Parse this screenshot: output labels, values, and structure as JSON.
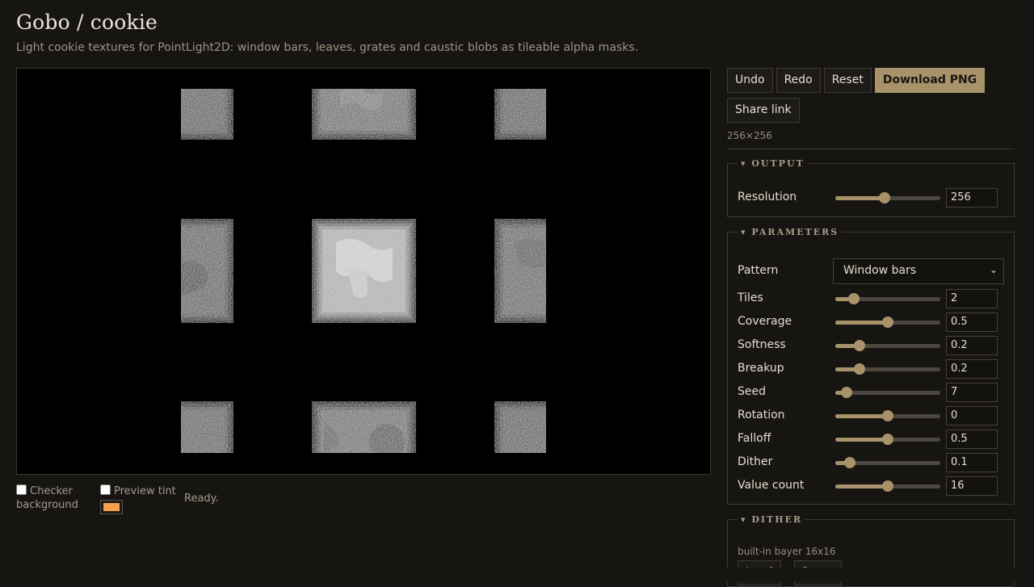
{
  "header": {
    "title": "Gobo / cookie",
    "subtitle": "Light cookie textures for PointLight2D: window bars, leaves, grates and caustic blobs as tileable alpha masks."
  },
  "toolbar": {
    "undo": "Undo",
    "redo": "Redo",
    "reset": "Reset",
    "download": "Download PNG",
    "share": "Share link",
    "dimensions": "256×256"
  },
  "output": {
    "legend": "▾ OUTPUT",
    "resolution_label": "Resolution",
    "resolution_value": "256",
    "resolution_fraction": 0.47
  },
  "parameters": {
    "legend": "▾ PARAMETERS",
    "pattern_label": "Pattern",
    "pattern_value": "Window bars",
    "rows": [
      {
        "label": "Tiles",
        "value": "2",
        "fraction": 0.18
      },
      {
        "label": "Coverage",
        "value": "0.5",
        "fraction": 0.5
      },
      {
        "label": "Softness",
        "value": "0.2",
        "fraction": 0.23
      },
      {
        "label": "Breakup",
        "value": "0.2",
        "fraction": 0.23
      },
      {
        "label": "Seed",
        "value": "7",
        "fraction": 0.11
      },
      {
        "label": "Rotation",
        "value": "0",
        "fraction": 0.5
      },
      {
        "label": "Falloff",
        "value": "0.5",
        "fraction": 0.5
      },
      {
        "label": "Dither",
        "value": "0.1",
        "fraction": 0.14
      },
      {
        "label": "Value count",
        "value": "16",
        "fraction": 0.5
      }
    ]
  },
  "dither": {
    "legend": "▾ DITHER",
    "note": "built-in bayer 16x16",
    "load": "Load",
    "reset": "Reset"
  },
  "preview": {
    "checker_label": "Checker background",
    "checker_checked": false,
    "tint_label": "Preview tint",
    "tint_checked": false,
    "tint_color": "#f5a04a",
    "status": "Ready."
  },
  "colors": {
    "accent": "#a8926a",
    "background": "#171512",
    "panel_border": "#3d3931"
  }
}
